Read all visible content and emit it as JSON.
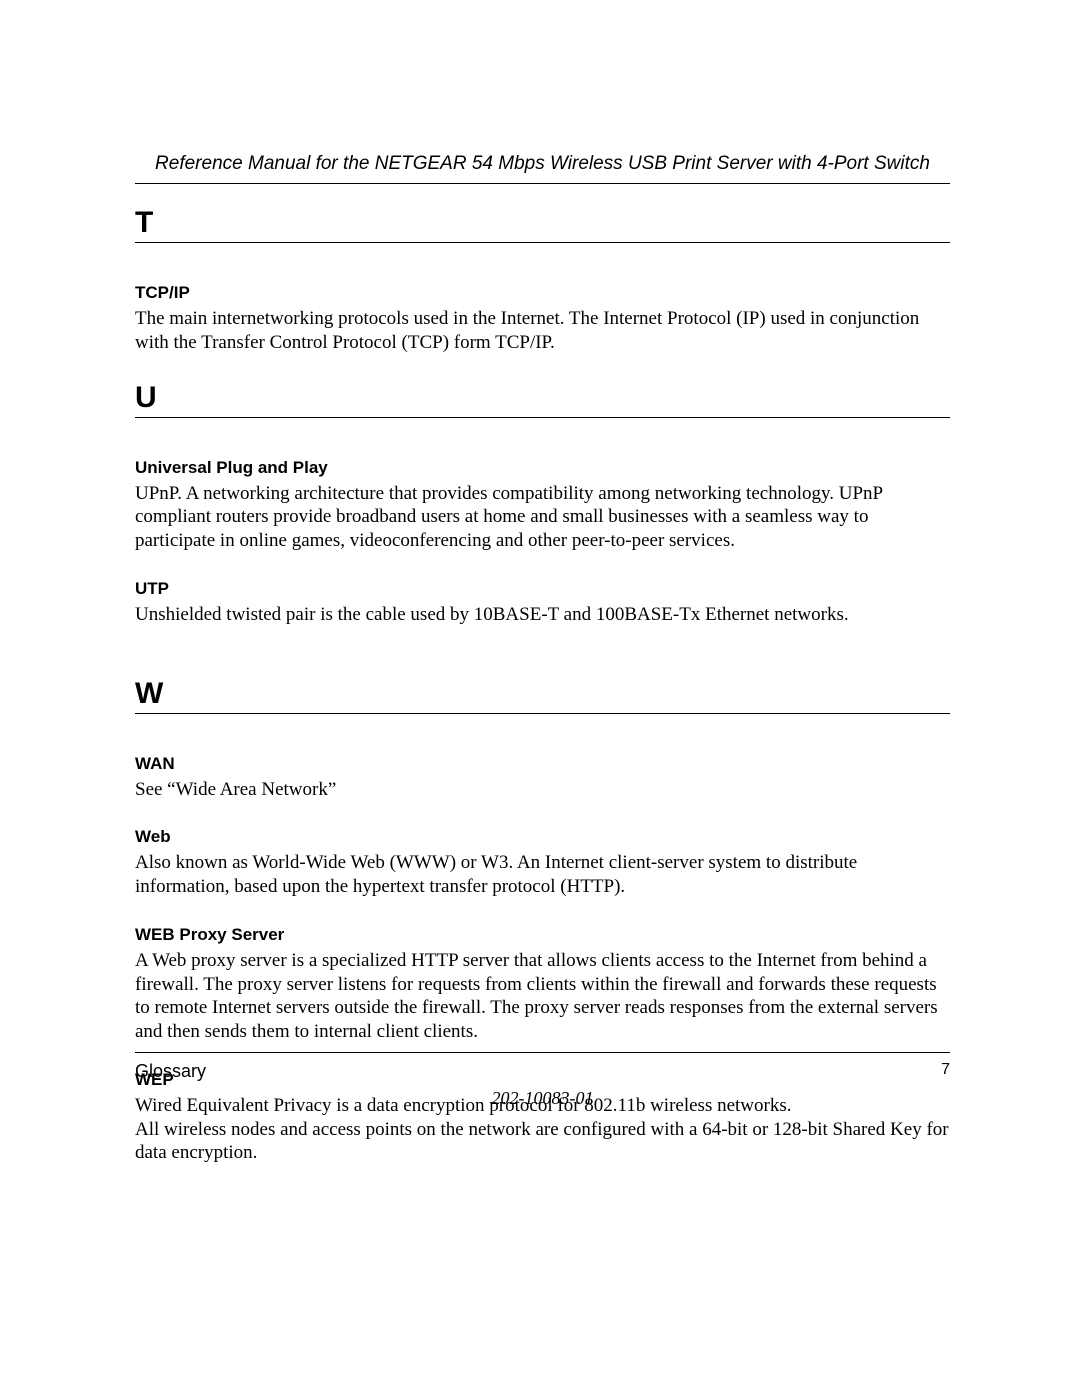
{
  "header": {
    "title": "Reference Manual for the NETGEAR 54 Mbps Wireless USB Print Server with 4-Port Switch"
  },
  "sections": {
    "T": {
      "letter": "T",
      "entries": {
        "tcpip": {
          "term": "TCP/IP",
          "definition": "The main internetworking protocols used in the Internet. The Internet Protocol (IP) used in conjunction with the Transfer Control Protocol (TCP) form TCP/IP."
        }
      }
    },
    "U": {
      "letter": "U",
      "entries": {
        "upnp": {
          "term": "Universal Plug and Play",
          "definition": "UPnP. A networking architecture that provides compatibility among networking technology. UPnP compliant routers provide broadband users at home and small businesses with a seamless way to participate in online games, videoconferencing and other peer-to-peer services."
        },
        "utp": {
          "term": "UTP",
          "definition": "Unshielded twisted pair is the cable used by 10BASE-T and 100BASE-Tx Ethernet networks."
        }
      }
    },
    "W": {
      "letter": "W",
      "entries": {
        "wan": {
          "term": "WAN",
          "definition": "See “Wide Area Network”"
        },
        "web": {
          "term": "Web",
          "definition": "Also known as World-Wide Web (WWW) or W3. An Internet client-server system to distribute information, based upon the hypertext transfer protocol (HTTP)."
        },
        "webproxy": {
          "term": "WEB Proxy Server",
          "definition": "A Web proxy server is a specialized HTTP server that allows clients access to the Internet from behind a firewall. The proxy server listens for requests from clients within the firewall and forwards these requests to remote Internet servers outside the firewall. The proxy server reads responses from the external servers and then sends them to internal client clients."
        },
        "wep": {
          "term": "WEP",
          "definition": "Wired Equivalent Privacy is a data encryption protocol for 802.11b wireless networks.\nAll wireless nodes and access points on the network are configured with a 64-bit or 128-bit Shared Key for data encryption."
        }
      }
    }
  },
  "footer": {
    "section": "Glossary",
    "page": "7",
    "docnum": "202-10083-01"
  }
}
